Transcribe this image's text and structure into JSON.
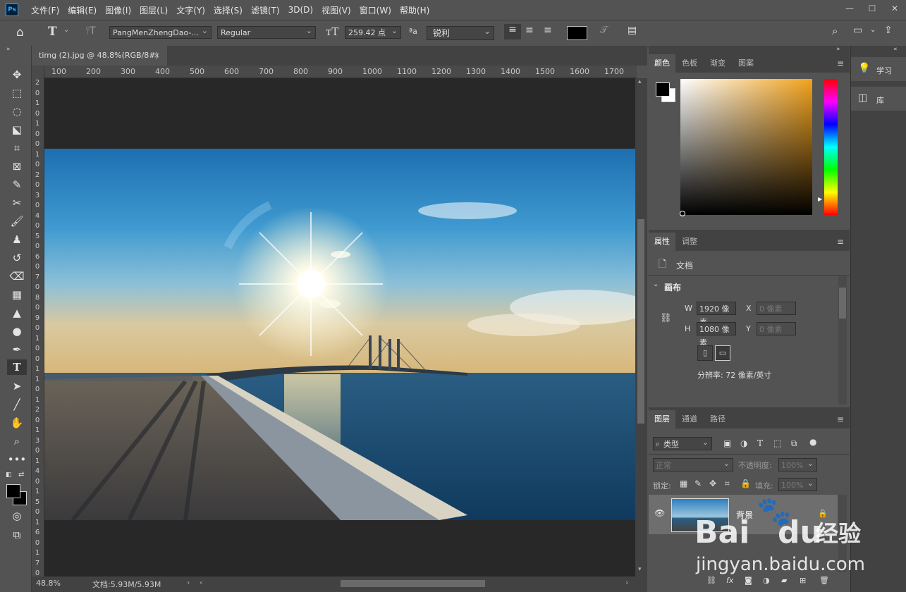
{
  "app": {
    "logo": "Ps"
  },
  "menu": [
    "文件(F)",
    "编辑(E)",
    "图像(I)",
    "图层(L)",
    "文字(Y)",
    "选择(S)",
    "滤镜(T)",
    "3D(D)",
    "视图(V)",
    "窗口(W)",
    "帮助(H)"
  ],
  "options": {
    "font_family": "PangMenZhengDao-...",
    "font_style": "Regular",
    "font_size": "259.42 点",
    "anti_alias": "锐利",
    "text_color": "#000000"
  },
  "document": {
    "tab_title": "timg (2).jpg @ 48.8%(RGB/8#)",
    "tab_close": "×",
    "zoom": "48.8%",
    "doc_info": "文档:5.93M/5.93M"
  },
  "ruler": {
    "top": [
      "100",
      "200",
      "300",
      "400",
      "500",
      "600",
      "700",
      "800",
      "900",
      "1000",
      "1100",
      "1200",
      "1300",
      "1400",
      "1500",
      "1600",
      "1700"
    ],
    "left": [
      "2",
      "0",
      "1",
      "0",
      "1",
      "0",
      "0",
      "1",
      "0",
      "2",
      "0",
      "3",
      "0",
      "4",
      "0",
      "5",
      "0",
      "6",
      "0",
      "7",
      "0",
      "8",
      "0",
      "9",
      "0",
      "1",
      "0",
      "0",
      "1",
      "1",
      "0",
      "1",
      "2",
      "0",
      "1",
      "3",
      "0",
      "1",
      "4",
      "0",
      "1",
      "5",
      "0",
      "1",
      "6",
      "0",
      "1",
      "7",
      "0"
    ]
  },
  "color_panel": {
    "tabs": [
      "颜色",
      "色板",
      "渐变",
      "图案"
    ],
    "fg": "#000000",
    "bg": "#ffffff",
    "hue_color": "#f2a21c"
  },
  "properties_panel": {
    "tabs": [
      "属性",
      "调整"
    ],
    "doc_label": "文档",
    "section": "画布",
    "w_label": "W",
    "w_value": "1920 像素",
    "h_label": "H",
    "h_value": "1080 像素",
    "x_label": "X",
    "x_placeholder": "0 像素",
    "y_label": "Y",
    "y_placeholder": "0 像素",
    "resolution": "分辨率: 72 像素/英寸"
  },
  "layers_panel": {
    "tabs": [
      "图层",
      "通道",
      "路径"
    ],
    "filter": "类型",
    "blend_mode": "正常",
    "opacity_label": "不透明度:",
    "opacity_value": "100%",
    "lock_label": "锁定:",
    "fill_label": "填充:",
    "fill_value": "100%",
    "layer_name": "背景"
  },
  "side_panels": [
    {
      "label": "学习"
    },
    {
      "label": "库"
    }
  ],
  "watermark": {
    "brand": "Bai",
    "brand2": "du",
    "suffix": "经验",
    "url": "jingyan.baidu.com"
  }
}
